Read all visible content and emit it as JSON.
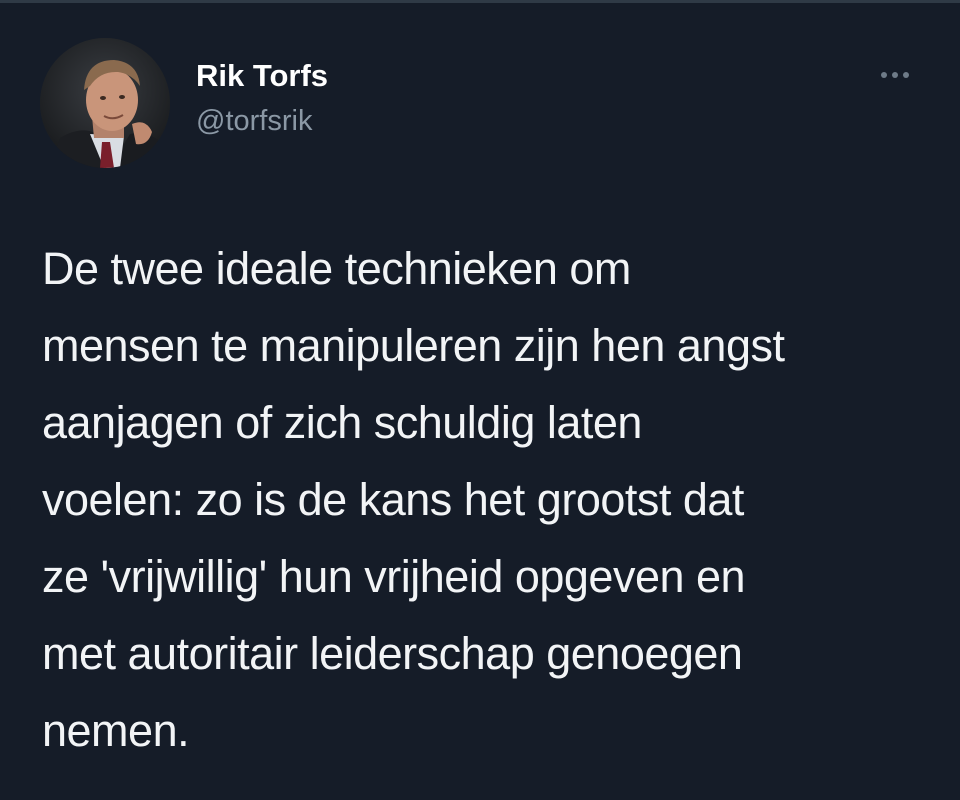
{
  "tweet": {
    "author": {
      "display_name": "Rik Torfs",
      "handle": "@torfsrik"
    },
    "text": "De twee ideale technieken om\nmensen te manipuleren zijn hen angst\naanjagen of zich schuldig laten\nvoelen: zo is de kans het grootst dat\nze 'vrijwillig' hun vrijheid opgeven en\nmet autoritair leiderschap genoegen\nnemen."
  },
  "icons": {
    "more": "more-horizontal-icon"
  },
  "colors": {
    "background": "#151c28",
    "text": "#f2f4f6",
    "handle": "#8b98a5",
    "icon": "#6e7b88",
    "divider": "#2f3a46"
  }
}
